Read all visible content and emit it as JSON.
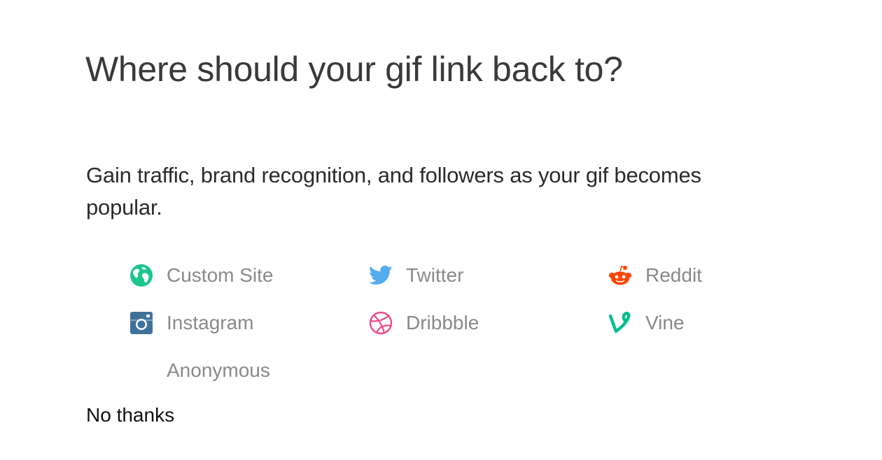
{
  "heading": "Where should your gif link back to?",
  "description": "Gain traffic, brand recognition, and followers as your gif becomes popular.",
  "options": [
    {
      "label": "Custom Site",
      "icon": "globe-icon",
      "color": "#1bc68a"
    },
    {
      "label": "Twitter",
      "icon": "twitter-bird-icon",
      "color": "#55acee"
    },
    {
      "label": "Reddit",
      "icon": "reddit-alien-icon",
      "color": "#ff4500"
    },
    {
      "label": "Instagram",
      "icon": "instagram-icon",
      "color": "#3f729b"
    },
    {
      "label": "Dribbble",
      "icon": "dribbble-ball-icon",
      "color": "#ea4c89"
    },
    {
      "label": "Vine",
      "icon": "vine-icon",
      "color": "#00bf8f"
    },
    {
      "label": "Anonymous",
      "icon": null,
      "color": null
    }
  ],
  "no_thanks": "No thanks",
  "colors": {
    "heading": "#3a3a3a",
    "option_label": "#8a8a8a",
    "background": "#ffffff"
  }
}
